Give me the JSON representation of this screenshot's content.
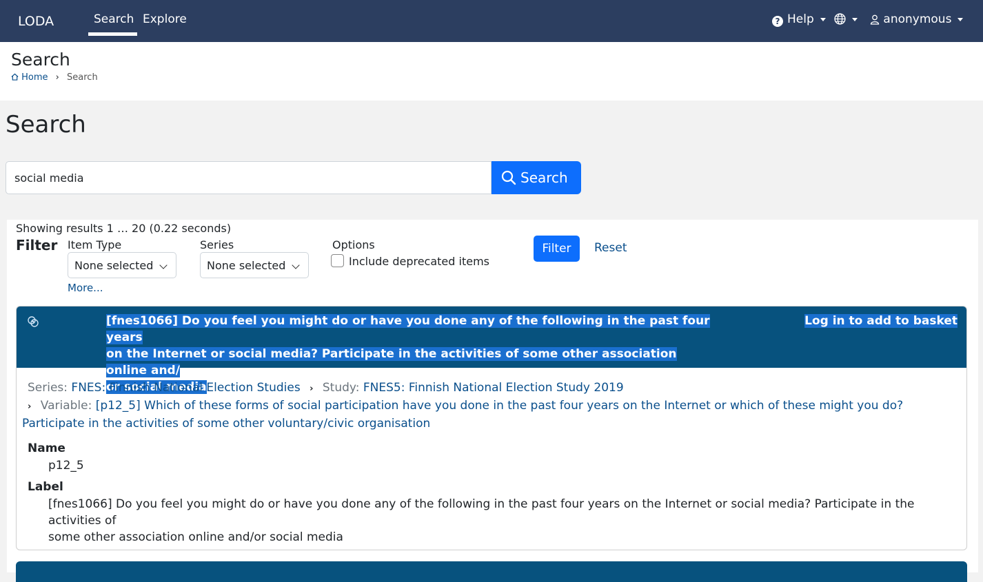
{
  "navbar": {
    "brand": "LODA",
    "tabs": [
      {
        "label": "Search",
        "active": true
      },
      {
        "label": "Explore",
        "active": false
      }
    ],
    "help_label": "Help",
    "user_label": "anonymous",
    "bg_color": "#2c3e60"
  },
  "page_header": {
    "title": "Search",
    "breadcrumb": {
      "home": "Home",
      "current": "Search"
    }
  },
  "search": {
    "title": "Search",
    "query": "social media",
    "button_label": "Search",
    "button_color": "#0d6efd"
  },
  "results": {
    "showing": "Showing results 1 … 20 (0.22 seconds)",
    "filter": {
      "label": "Filter",
      "item_type_label": "Item Type",
      "item_type_value": "None selected",
      "series_label": "Series",
      "series_value": "None selected",
      "options_label": "Options",
      "include_deprecated_label": "Include deprecated items",
      "include_deprecated_checked": false,
      "more_label": "More...",
      "filter_button": "Filter",
      "reset_link": "Reset"
    },
    "items": [
      {
        "title_lines": [
          "[fnes1066] Do you feel you might do or have you done any of the following in the past four years",
          "on the Internet or social media? Participate in the activities of some other association online and/",
          "or social media"
        ],
        "basket_label": "Log in to add to basket",
        "series_prefix": "Series:",
        "series": "FNES: Finnish National Election Studies",
        "study_prefix": "Study:",
        "study": "FNES5: Finnish National Election Study 2019",
        "variable_prefix": "Variable:",
        "variable": "[p12_5] Which of these forms of social participation have you done in the past four years on the Internet or which of these might you do? Participate in the activities of some other voluntary/civic organisation",
        "name_label": "Name",
        "name": "p12_5",
        "label_label": "Label",
        "label_lines": [
          "[fnes1066] Do you feel you might do or have you done any of the following in the past four years on the Internet or social media? Participate in the activities of",
          "some other association online and/or social media"
        ],
        "header_color": "#07527e"
      }
    ]
  }
}
